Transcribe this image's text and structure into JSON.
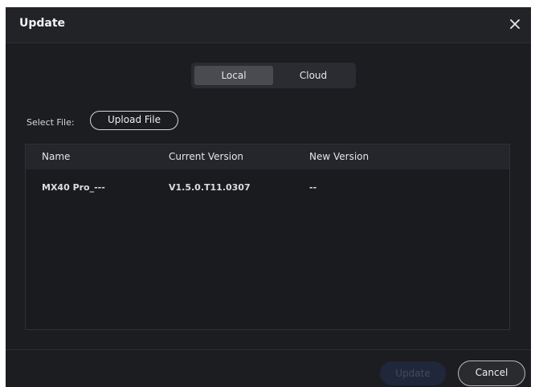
{
  "dialog": {
    "title": "Update",
    "close_icon": "close-icon"
  },
  "source_tabs": {
    "items": [
      {
        "label": "Local",
        "selected": true
      },
      {
        "label": "Cloud",
        "selected": false
      }
    ]
  },
  "file_select": {
    "label": "Select File:",
    "upload_button": "Upload File"
  },
  "table": {
    "columns": [
      "Name",
      "Current Version",
      "New Version"
    ],
    "rows": [
      {
        "name": "MX40 Pro_---",
        "current_version": "V1.5.0.T11.0307",
        "new_version": "--"
      }
    ]
  },
  "footer": {
    "update_button": "Update",
    "update_enabled": false,
    "cancel_button": "Cancel"
  },
  "colors": {
    "background": "#1c1d21",
    "header": "#222327",
    "tab_selected": "#4a4b51",
    "update_disabled_bg": "#20273a",
    "update_disabled_text": "#3e4a66"
  }
}
